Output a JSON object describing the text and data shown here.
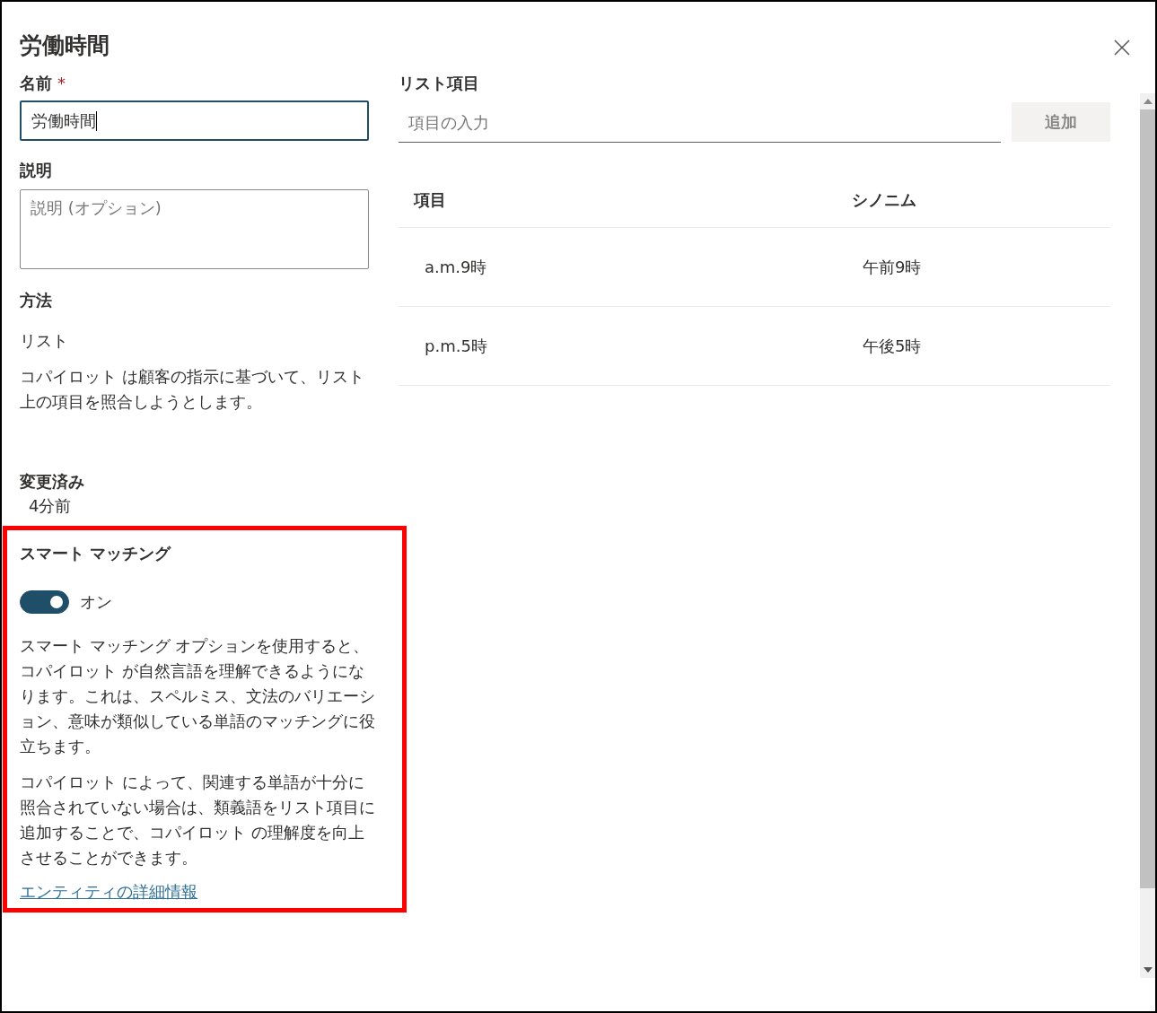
{
  "dialog": {
    "title": "労働時間"
  },
  "name_field": {
    "label": "名前",
    "required_mark": "*",
    "value": "労働時間",
    "focused": true
  },
  "description_field": {
    "label": "説明",
    "placeholder": "説明 (オプション)"
  },
  "method": {
    "label": "方法",
    "value": "リスト",
    "description": "コパイロット は顧客の指示に基づいて、リスト上の項目を照合しようとします。"
  },
  "modified": {
    "label": "変更済み",
    "value": "4分前"
  },
  "smart_matching": {
    "title": "スマート マッチング",
    "toggle": {
      "on": true,
      "label": "オン"
    },
    "paragraphs": [
      "スマート マッチング オプションを使用すると、コパイロット が自然言語を理解できるようになります。これは、スペルミス、文法のバリエーション、意味が類似している単語のマッチングに役立ちます。",
      "コパイロット によって、関連する単語が十分に照合されていない場合は、類義語をリスト項目に追加することで、コパイロット の理解度を向上させることができます。"
    ],
    "link": "エンティティの詳細情報"
  },
  "list_items": {
    "label": "リスト項目",
    "input": {
      "placeholder": "項目の入力"
    },
    "add_button": {
      "label": "追加",
      "disabled": true
    },
    "columns": [
      "項目",
      "シノニム"
    ],
    "rows": [
      {
        "item": "a.m.9時",
        "synonym": "午前9時"
      },
      {
        "item": "p.m.5時",
        "synonym": "午後5時"
      }
    ]
  }
}
